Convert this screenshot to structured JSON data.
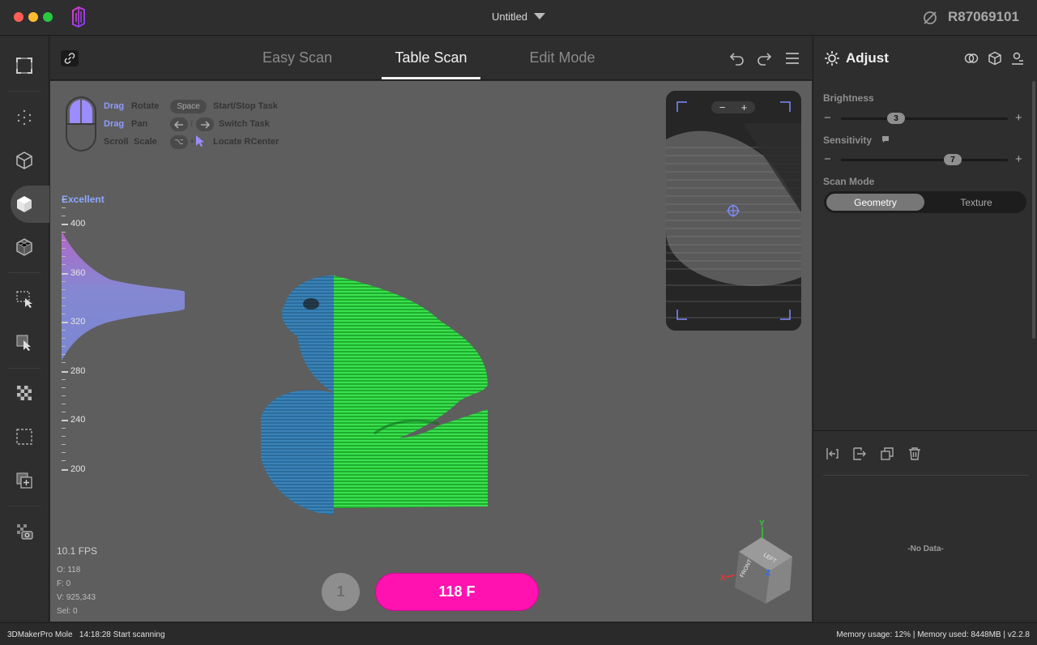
{
  "window": {
    "title": "Untitled",
    "device_id": "R87069101"
  },
  "tabs": [
    {
      "label": "Easy Scan",
      "active": false
    },
    {
      "label": "Table Scan",
      "active": true
    },
    {
      "label": "Edit Mode",
      "active": false
    }
  ],
  "hints": {
    "drag_rotate_key": "Drag",
    "drag_rotate": "Rotate",
    "drag_pan_key": "Drag",
    "drag_pan": "Pan",
    "scroll_key": "Scroll",
    "scroll": "Scale",
    "space_key": "Space",
    "space": "Start/Stop Task",
    "switch_separator": "/",
    "switch": "Switch Task",
    "alt_key": "⌥",
    "plus": "+",
    "locate": "Locate RCenter"
  },
  "quality": {
    "label": "Excellent",
    "scale_labels": [
      "400",
      "360",
      "320",
      "280",
      "240",
      "200"
    ]
  },
  "stats": {
    "fps": "10.1 FPS",
    "o": "O: 118",
    "f": "F: 0",
    "v": "V: 925,343",
    "sel": "Sel: 0"
  },
  "preview": {
    "zoom_out": "−",
    "zoom_in": "+"
  },
  "scan": {
    "shot_count": "1",
    "frames_label": "118 F"
  },
  "view_cube": {
    "top": "LEFT",
    "front": "FRONT",
    "x": "X",
    "y": "Y",
    "z": "Z"
  },
  "adjust": {
    "title": "Adjust",
    "brightness_label": "Brightness",
    "brightness_value": "3",
    "brightness_level": 0.33,
    "sensitivity_label": "Sensitivity",
    "sensitivity_value": "7",
    "sensitivity_level": 0.67,
    "minus": "−",
    "plus": "+",
    "scan_mode_label": "Scan Mode",
    "scan_modes": [
      "Geometry",
      "Texture"
    ],
    "selected_mode": "Geometry"
  },
  "data_panel": {
    "empty": "-No Data-"
  },
  "status": {
    "left": "3DMakerPro Mole   14:18:28 Start scanning",
    "right": "Memory usage: 12% | Memory used: 8448MB | v2.2.8"
  },
  "colors": {
    "accent_pink": "#ff12b0",
    "quality_blue": "#8ea8ff",
    "scan_green": "#22c93a",
    "scan_blue": "#2a6fa0"
  }
}
